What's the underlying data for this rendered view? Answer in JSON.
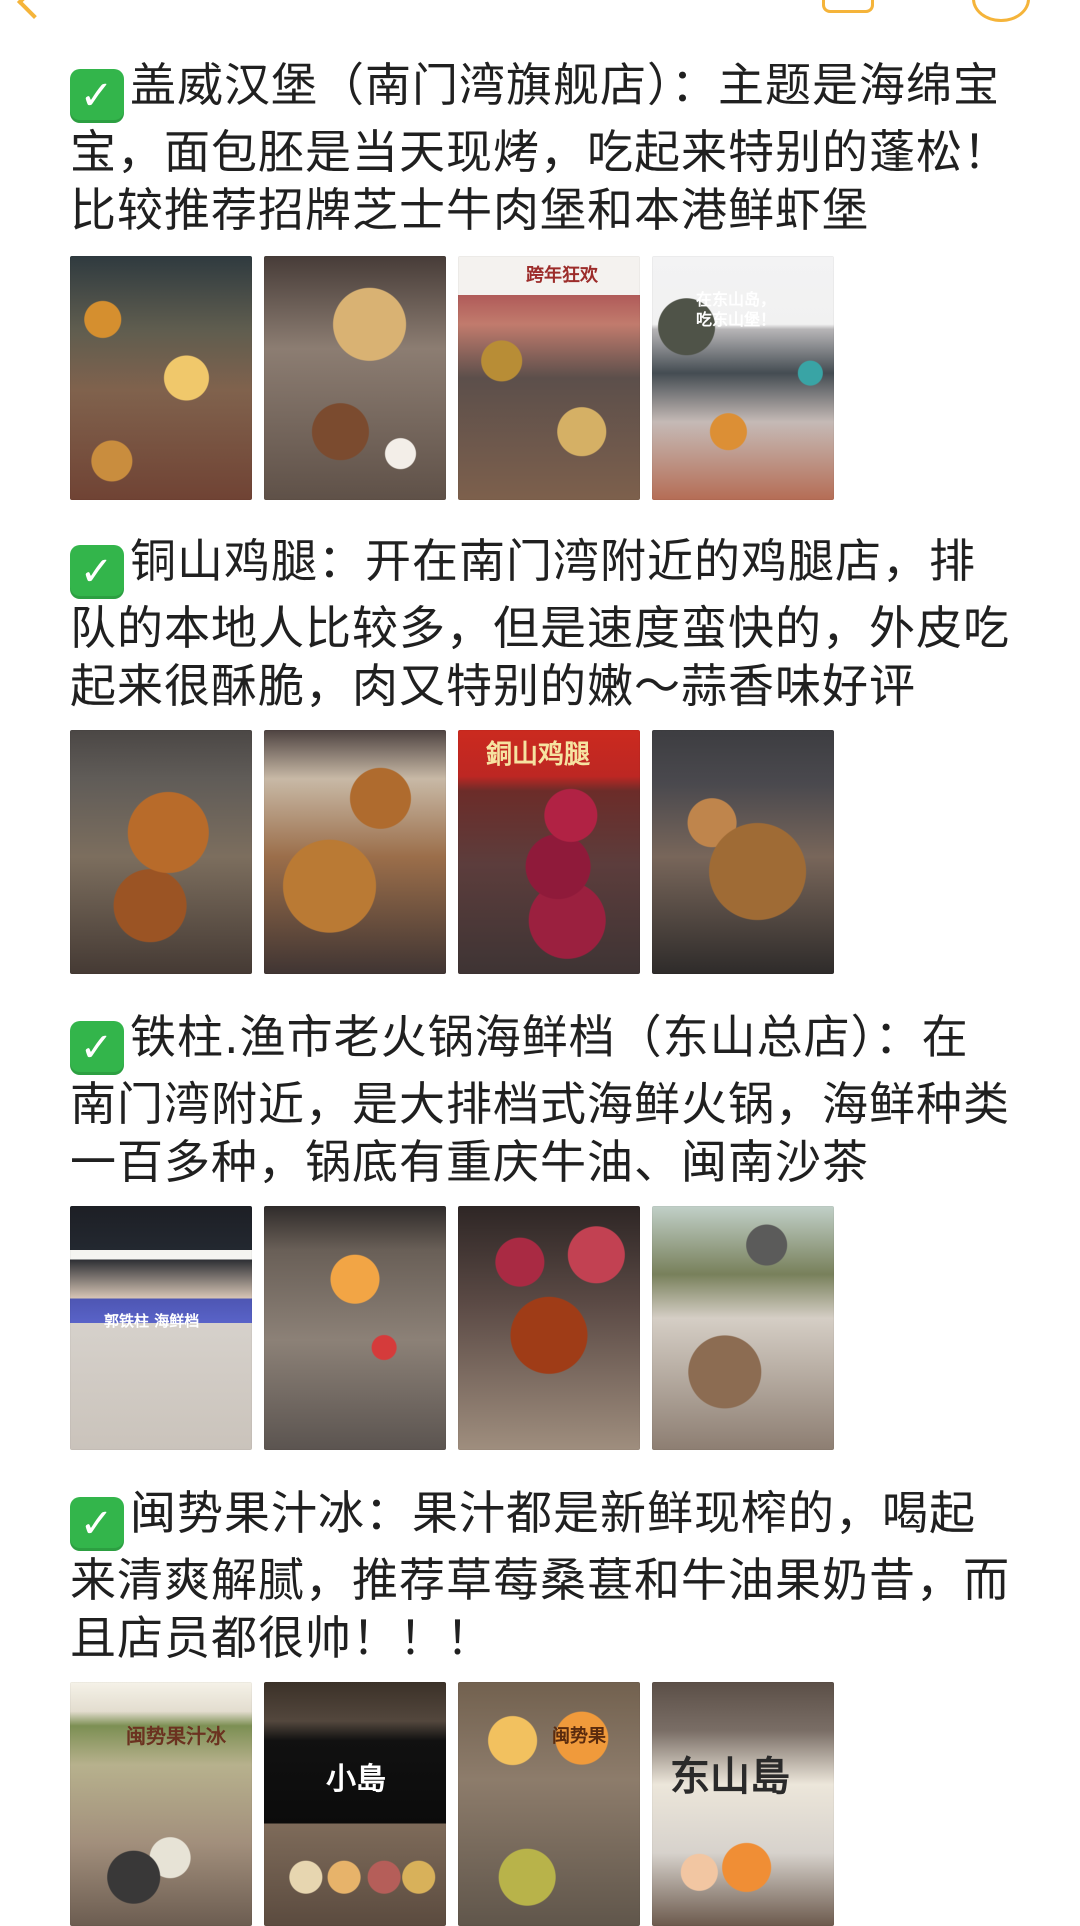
{
  "header": {
    "back_label": "",
    "title": ""
  },
  "sections": [
    {
      "check_icon_label": "✓",
      "text": "盖威汉堡（南门湾旗舰店）：主题是海绵宝宝，面包胚是当天现烤，吃起来特别的蓬松！比较推荐招牌芝士牛肉堡和本港鲜虾堡",
      "images": [
        {
          "name": "burger-photo-1",
          "style": "bg1",
          "caption": ""
        },
        {
          "name": "burger-photo-2",
          "style": "bg2",
          "caption": ""
        },
        {
          "name": "burger-photo-3",
          "style": "bg3",
          "caption": "跨年狂欢"
        },
        {
          "name": "burger-photo-4",
          "style": "bg4",
          "caption": "在东山岛，吃东山堡！"
        }
      ]
    },
    {
      "check_icon_label": "✓",
      "text": "铜山鸡腿：开在南门湾附近的鸡腿店，排队的本地人比较多，但是速度蛮快的，外皮吃起来很酥脆，肉又特别的嫩～蒜香味好评",
      "images": [
        {
          "name": "chicken-photo-1",
          "style": "cg1",
          "caption": ""
        },
        {
          "name": "chicken-photo-2",
          "style": "cg2",
          "caption": ""
        },
        {
          "name": "chicken-photo-3",
          "style": "cg3",
          "caption": "銅山鸡腿"
        },
        {
          "name": "chicken-photo-4",
          "style": "cg4",
          "caption": ""
        }
      ]
    },
    {
      "check_icon_label": "✓",
      "text": "铁柱.渔市老火锅海鲜档（东山总店）：在南门湾附近，是大排档式海鲜火锅，海鲜种类一百多种，锅底有重庆牛油、闽南沙茶",
      "images": [
        {
          "name": "seafood-photo-1",
          "style": "sg1",
          "caption": "郭铁柱 海鲜档"
        },
        {
          "name": "seafood-photo-2",
          "style": "sg2",
          "caption": ""
        },
        {
          "name": "seafood-photo-3",
          "style": "sg3",
          "caption": ""
        },
        {
          "name": "seafood-photo-4",
          "style": "sg4",
          "caption": ""
        }
      ]
    },
    {
      "check_icon_label": "✓",
      "text": "闽势果汁冰：果汁都是新鲜现榨的，喝起来清爽解腻，推荐草莓桑葚和牛油果奶昔，而且店员都很帅！！！",
      "images": [
        {
          "name": "juice-photo-1",
          "style": "jg1",
          "caption": "闽势果汁冰"
        },
        {
          "name": "juice-photo-2",
          "style": "jg2",
          "caption": "小島"
        },
        {
          "name": "juice-photo-3",
          "style": "jg3",
          "caption": "闽势果"
        },
        {
          "name": "juice-photo-4",
          "style": "jg4",
          "caption": "东山島"
        }
      ]
    }
  ]
}
